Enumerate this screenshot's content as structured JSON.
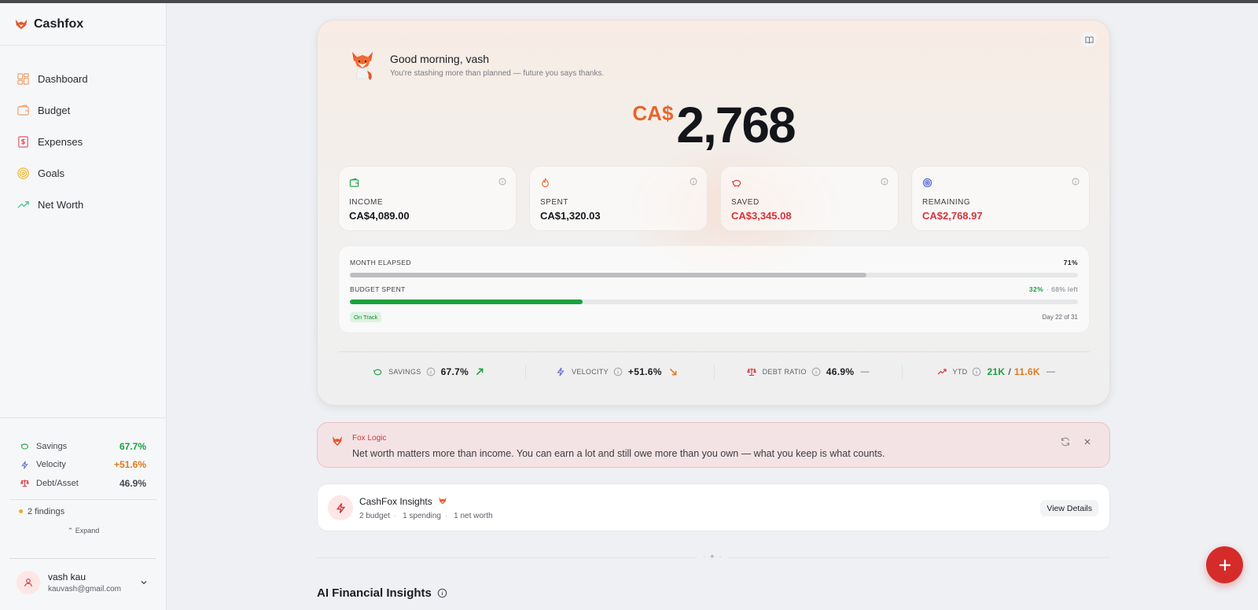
{
  "app": {
    "name": "Cashfox"
  },
  "sidebar": {
    "nav": [
      {
        "label": "Dashboard",
        "icon": "dashboard-icon"
      },
      {
        "label": "Budget",
        "icon": "wallet-icon"
      },
      {
        "label": "Expenses",
        "icon": "receipt-icon"
      },
      {
        "label": "Goals",
        "icon": "target-icon"
      },
      {
        "label": "Net Worth",
        "icon": "trending-up-icon"
      }
    ],
    "metrics": [
      {
        "label": "Savings",
        "value": "67.7%",
        "color": "#19a23d"
      },
      {
        "label": "Velocity",
        "value": "+51.6%",
        "color": "#e07a1e"
      },
      {
        "label": "Debt/Asset",
        "value": "46.9%",
        "color": "#1b1d22"
      }
    ],
    "findings": "2 findings",
    "expand_label": "Expand",
    "user": {
      "name": "vash kau",
      "email": "kauvash@gmail.com"
    }
  },
  "hero": {
    "greeting": "Good morning, vash",
    "subtitle": "You're stashing more than planned — future you says thanks.",
    "currency": "CA$",
    "amount": "2,768",
    "stats": [
      {
        "label": "INCOME",
        "value": "CA$4,089.00",
        "icon": "wallet-icon"
      },
      {
        "label": "SPENT",
        "value": "CA$1,320.03",
        "icon": "flame-icon"
      },
      {
        "label": "SAVED",
        "value": "CA$3,345.08",
        "icon": "piggy-bank-icon"
      },
      {
        "label": "REMAINING",
        "value": "CA$2,768.97",
        "icon": "target-icon"
      }
    ],
    "progress": {
      "month_label": "MONTH ELAPSED",
      "month_pct": "71%",
      "month_fraction": 0.71,
      "budget_label": "BUDGET SPENT",
      "budget_pct": "32%",
      "budget_left": "· 68% left",
      "budget_fraction": 0.32,
      "status": "On Track",
      "day": "Day 22 of 31"
    },
    "kpis": {
      "savings": {
        "label": "SAVINGS",
        "value": "67.7%"
      },
      "velocity": {
        "label": "VELOCITY",
        "value": "+51.6%"
      },
      "debt": {
        "label": "DEBT RATIO",
        "value": "46.9%",
        "trend": "—"
      },
      "ytd": {
        "label": "YTD",
        "a": "21K",
        "sep": "/",
        "b": "11.6K",
        "trend": "—"
      }
    }
  },
  "fox_logic": {
    "title": "Fox Logic",
    "text": "Net worth matters more than income. You can earn a lot and still owe more than you own — what you keep is what counts."
  },
  "insights": {
    "title": "CashFox Insights",
    "tags": [
      "2 budget",
      "1 spending",
      "1 net worth"
    ],
    "button": "View Details"
  },
  "section_title": "AI Financial Insights",
  "colors": {
    "accent": "#d62b2b",
    "orange": "#e8652a",
    "green": "#19a23d"
  }
}
